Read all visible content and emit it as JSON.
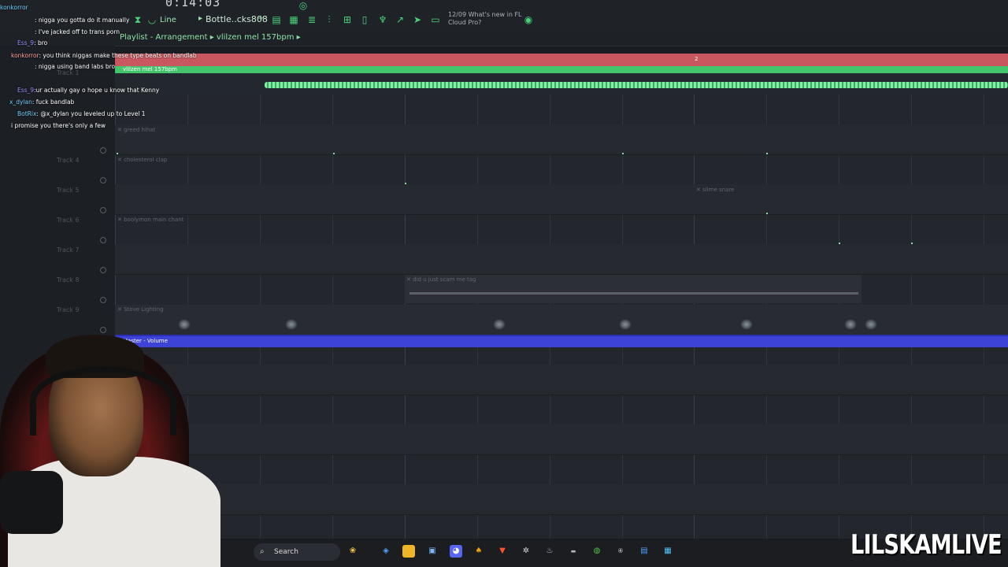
{
  "topbar": {
    "time": "0:14:03",
    "mode": "Line",
    "pattern": "Bottle..cks808",
    "news_date": "12/09",
    "news_line1": "What's new in FL",
    "news_line2": "Cloud Pro?"
  },
  "playlist": {
    "breadcrumb": "Playlist - Arrangement",
    "project": "vlilzen mel 157bpm",
    "ruler_marker": "2"
  },
  "tracks": {
    "t1": "Track 1",
    "t4": "Track 4",
    "t5": "Track 5",
    "t6": "Track 6",
    "t7": "Track 7",
    "t8": "Track 8",
    "t9": "Track 9"
  },
  "clips": {
    "main": "vlilzen mel 157bpm",
    "greed": "greed hihat",
    "cholesterol": "cholesterol clap",
    "slime": "slime snare",
    "boolymon": "boolymon main chant",
    "scam": "did u just scam me tag",
    "stove": "Stove Lighting",
    "master": "Master - Volume"
  },
  "chat": [
    {
      "user": "konkorror",
      "msg": ""
    },
    {
      "user": "",
      "msg": ": nigga you gotta do it manually"
    },
    {
      "user": "",
      "msg": ": I've jacked off to trans porn"
    },
    {
      "user": "Ess_9",
      "msg": ": bro"
    },
    {
      "user": "konkorror",
      "msg": ": you think niggas make these type beats on bandlab"
    },
    {
      "user": "",
      "msg": ": nigga using band labs bro"
    },
    {
      "user": "Ess_9",
      "msg": ":ur actually gay o hope u know that Kenny"
    },
    {
      "user": "x_dylan",
      "msg": ": fuck bandlab"
    },
    {
      "user": "BotRix",
      "msg": ": @x_dylan you leveled up to Level 1"
    },
    {
      "user": "",
      "msg": "i promise you there's only a few"
    }
  ],
  "taskbar": {
    "search": "Search"
  },
  "brand": "LILSKAMLIVE"
}
